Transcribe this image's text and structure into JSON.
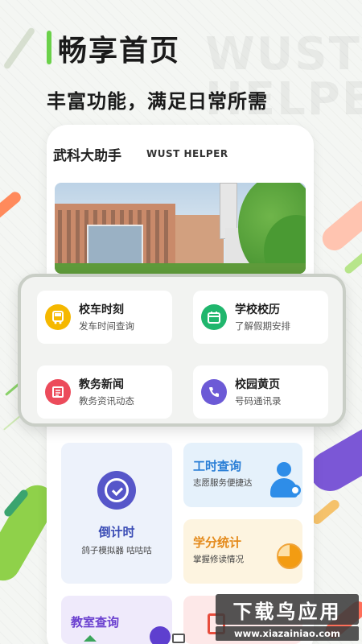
{
  "hero": {
    "title": "畅享首页",
    "subtitle": "丰富功能，满足日常所需",
    "watermark": "WUST HELPER"
  },
  "app": {
    "title": "武科大助手",
    "title_en": "WUST HELPER",
    "banner_image": "campus building photo"
  },
  "quick_tiles": [
    {
      "title": "校车时刻",
      "subtitle": "发车时间查询",
      "icon": "bus-icon",
      "color": "#f5b800"
    },
    {
      "title": "学校校历",
      "subtitle": "了解假期安排",
      "icon": "calendar-icon",
      "color": "#20b66d"
    },
    {
      "title": "教务新闻",
      "subtitle": "教务资讯动态",
      "icon": "news-icon",
      "color": "#ec4b5b"
    },
    {
      "title": "校园黄页",
      "subtitle": "号码通讯录",
      "icon": "phone-icon",
      "color": "#6c5ad6"
    }
  ],
  "grid": {
    "countdown": {
      "title": "倒计时",
      "subtitle": "鸽子模拟器 咕咕咕",
      "icon": "clock-check-icon"
    },
    "work_hours": {
      "title": "工时查询",
      "subtitle": "志愿服务便捷达",
      "icon": "person-icon"
    },
    "credits": {
      "title": "学分统计",
      "subtitle": "掌握修读情况",
      "icon": "pie-chart-icon"
    },
    "classroom": {
      "title": "教室查询",
      "icon": "classroom-icon"
    },
    "red_card": {
      "text": "...",
      "icon": "book-icon"
    }
  },
  "site_badge": {
    "main": "下载鸟应用",
    "url": "www.xiazainiao.com"
  }
}
